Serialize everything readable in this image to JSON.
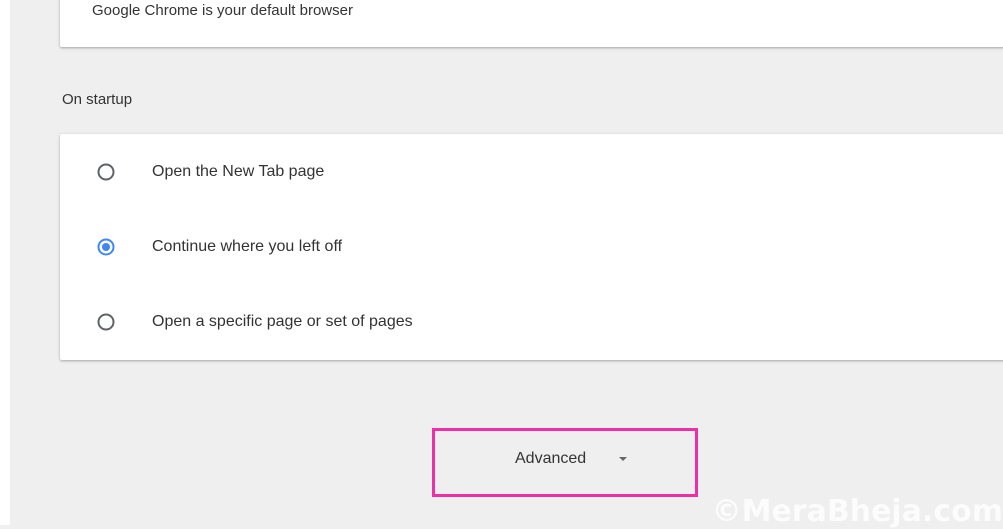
{
  "default_browser": {
    "text": "Google Chrome is your default browser"
  },
  "startup": {
    "section_title": "On startup",
    "options": [
      {
        "label": "Open the New Tab page",
        "selected": false
      },
      {
        "label": "Continue where you left off",
        "selected": true
      },
      {
        "label": "Open a specific page or set of pages",
        "selected": false
      }
    ]
  },
  "advanced": {
    "label": "Advanced"
  },
  "watermark": {
    "text": "©MeraBheja.com"
  },
  "colors": {
    "accent": "#4285f4",
    "highlight_box": "#ee2fa6",
    "page_background": "#efefef",
    "radio_unselected": "#5f6368"
  }
}
